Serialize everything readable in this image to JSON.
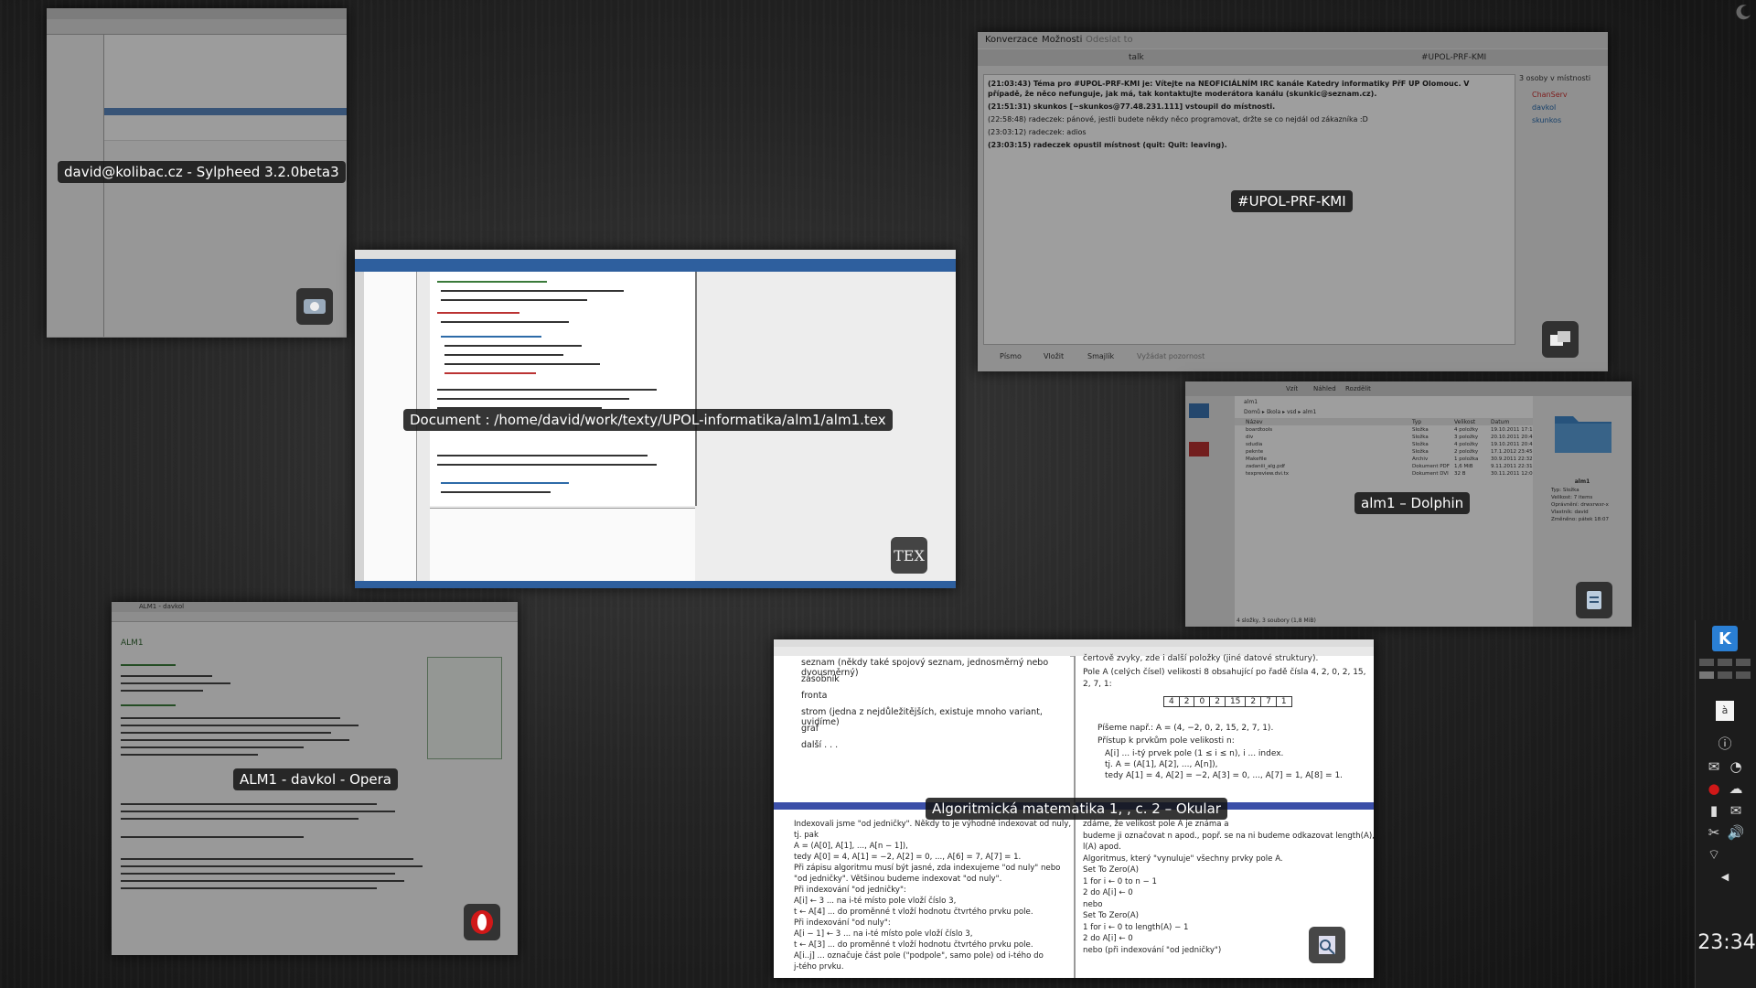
{
  "windows": {
    "sylpheed": {
      "caption": "david@kolibac.cz - Sylpheed 3.2.0beta3",
      "icon": "mail-client-icon"
    },
    "irc": {
      "caption": "#UPOL-PRF-KMI",
      "menu": [
        "Konverzace",
        "Možnosti",
        "Odeslat to"
      ],
      "tab_left": "talk",
      "tab_right": "#UPOL-PRF-KMI",
      "messages": [
        "(21:03:43) Téma pro #UPOL-PRF-KMI je: Vítejte na NEOFICIÁLNÍM IRC kanále Katedry informatiky PřF UP Olomouc. V případě, že něco nefunguje, jak má, tak kontaktujte moderátora kanálu (skunkic@seznam.cz).",
        "(21:51:31) skunkos [~skunkos@77.48.231.111] vstoupil do místnosti.",
        "(22:58:48) radeczek: pánové, jestli budete někdy něco programovat, držte se co nejdál od zákazníka :D",
        "(23:03:12) radeczek: adios",
        "(23:03:15) radeczek opustil místnost (quit: Quit: leaving)."
      ],
      "users_header": "3 osoby v místnosti",
      "users": [
        "ChanServ",
        "davkol",
        "skunkos"
      ],
      "toolbar": [
        "Písmo",
        "Vložit",
        "Smajlík",
        "Vyžádat pozornost"
      ],
      "icon": "chat-client-icon"
    },
    "texmaker": {
      "caption": "Document : /home/david/work/texty/UPOL-informatika/alm1/alm1.tex",
      "icon": "tex-editor-icon"
    },
    "dolphin": {
      "caption": "alm1 – Dolphin",
      "toolbar": [
        "Vzít",
        "Náhled",
        "Rozdělit"
      ],
      "path": "alm1",
      "breadcrumb": "Domů ▸ škola ▸ vsd ▸ alm1",
      "columns": [
        "Název",
        "Typ",
        "Velikost",
        "Datum"
      ],
      "files": [
        {
          "name": "boardtools",
          "type": "Složka",
          "size": "4 položky",
          "date": "19.10.2011 17:18"
        },
        {
          "name": "div",
          "type": "Složka",
          "size": "3 položky",
          "date": "20.10.2011 20:45"
        },
        {
          "name": "sdudia",
          "type": "Složka",
          "size": "4 položky",
          "date": "19.10.2011 20:45"
        },
        {
          "name": "peknte",
          "type": "Složka",
          "size": "2 položky",
          "date": "17.1.2012 23:45"
        },
        {
          "name": "Makefile",
          "type": "Archiv",
          "size": "1 položka",
          "date": "30.9.2011 22:32"
        },
        {
          "name": "zadaniii_alg.pdf",
          "type": "Dokument PDF",
          "size": "1,6 MiB",
          "date": "9.11.2011 22:31"
        },
        {
          "name": "texpreview.dvi.tx",
          "type": "Dokument DVI",
          "size": "32 B",
          "date": "30.11.2011 12:00"
        }
      ],
      "side_info_title": "alm1",
      "side_info": [
        "Typ: Složka",
        "Velikost: 7 items",
        "Oprávnění: drwxrwxr-x",
        "Vlastník: david",
        "Změněno: pátek 18:07"
      ],
      "status": "4 složky, 3 soubory (1,8 MiB)",
      "icon": "file-manager-icon"
    },
    "opera": {
      "caption": "ALM1 - davkol - Opera",
      "tab": "ALM1 - davkol",
      "page_title": "ALM1",
      "icon": "opera-icon"
    },
    "okular": {
      "caption": "Algoritmická matematika 1, , c. 2 – Okular",
      "page_tl": [
        "seznam (někdy také spojový seznam, jednosměrný nebo dvousměrný)",
        "zásobník",
        "fronta",
        "strom (jedna z nejdůležitějších, existuje mnoho variant, uvidíme)",
        "graf",
        "další . . ."
      ],
      "page_tr_top": "čertově zvyky, zde i další položky (jiné datové struktury).",
      "page_tr_text": "Pole A (celých čísel) velikosti 8 obsahující po řadě čísla 4, 2, 0, 2, 15, 2, 7, 1:",
      "array_cells": [
        "4",
        "2",
        "0",
        "2",
        "15",
        "2",
        "7",
        "1"
      ],
      "page_tr_lines": [
        "Píšeme např.: A = (4, −2, 0, 2, 15, 2, 7, 1).",
        "Přístup k prvkům pole velikosti n:",
        "A[i] ... i-tý prvek pole (1 ≤ i ≤ n), i ... index.",
        "tj. A = (A[1], A[2], ..., A[n]),",
        "tedy A[1] = 4, A[2] = −2, A[3] = 0, ..., A[7] = 1, A[8] = 1."
      ],
      "page_bl": [
        "Indexovali jsme \"od jedničky\". Někdy to je výhodné indexovat od nuly,",
        "tj. pak",
        "A = (A[0], A[1], ..., A[n − 1]),",
        "tedy A[0] = 4, A[1] = −2, A[2] = 0, ..., A[6] = 7, A[7] = 1.",
        "Při zápisu algoritmu musí být jasné, zda indexujeme \"od nuly\" nebo",
        "\"od jedničky\". Většinou budeme indexovat \"od nuly\".",
        "Při indexování \"od jedničky\":",
        "A[i] ← 3 ... na i-té místo pole vloží číslo 3,",
        "t ← A[4] ... do proměnné t vloží hodnotu čtvrtého prvku pole.",
        "Při indexování \"od nuly\":",
        "A[i − 1] ← 3 ... na i-té místo pole vloží číslo 3,",
        "t ← A[3] ... do proměnné t vloží hodnotu čtvrtého prvku pole.",
        "A[i..j] ... označuje část pole (\"podpole\", samo pole) od i-tého do",
        "j-tého prvku."
      ],
      "page_br": [
        "zdáme, že velikost pole A je známa a",
        "budeme ji označovat n apod., popř. se na ni budeme odkazovat length(A),",
        "l(A) apod.",
        "Algoritmus, který \"vynuluje\" všechny prvky pole A.",
        "Set To Zero(A)",
        "1   for i ← 0 to n − 1",
        "2     do A[i] ← 0",
        "nebo",
        "Set To Zero(A)",
        "1   for i ← 0 to length(A) − 1",
        "2     do A[i] ← 0",
        "nebo (při indexování \"od jedničky\")"
      ],
      "icon": "document-viewer-icon"
    }
  },
  "panel": {
    "clock": "23:34",
    "kmenu_icon": "kde-menu-icon"
  }
}
